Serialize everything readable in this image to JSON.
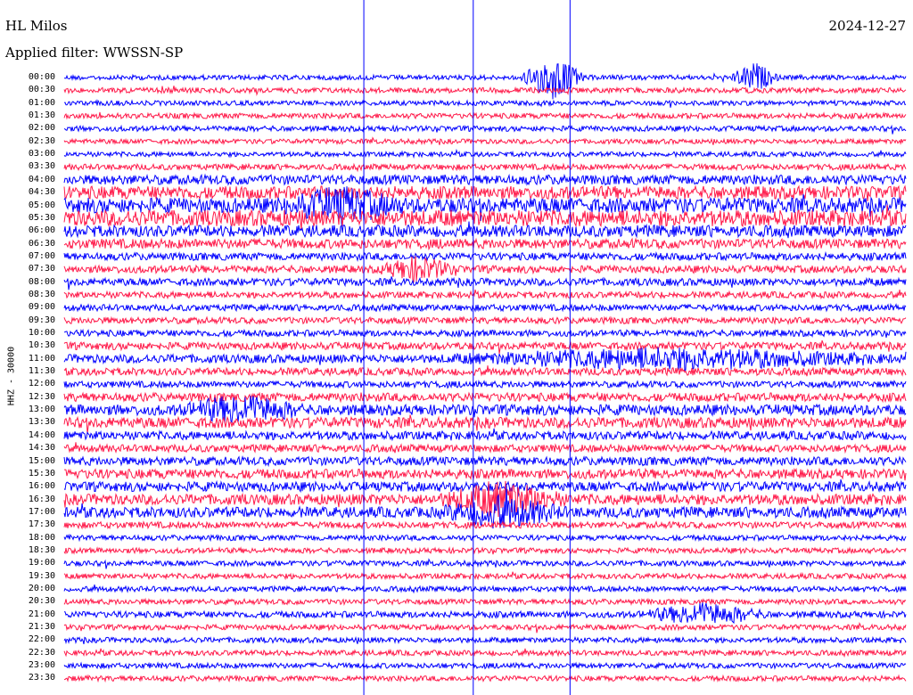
{
  "header": {
    "station": "HL Milos",
    "filter": "Applied filter: WWSSN-SP",
    "date": "2024-12-27"
  },
  "chart_data": {
    "type": "line",
    "ylabel": "HHZ - 30000",
    "rows": [
      "00:00",
      "00:30",
      "01:00",
      "01:30",
      "02:00",
      "02:30",
      "03:00",
      "03:30",
      "04:00",
      "04:30",
      "05:00",
      "05:30",
      "06:00",
      "06:30",
      "07:00",
      "07:30",
      "08:00",
      "08:30",
      "09:00",
      "09:30",
      "10:00",
      "10:30",
      "11:00",
      "11:30",
      "12:00",
      "12:30",
      "13:00",
      "13:30",
      "14:00",
      "14:30",
      "15:00",
      "15:30",
      "16:00",
      "16:30",
      "17:00",
      "17:30",
      "18:00",
      "18:30",
      "19:00",
      "19:30",
      "20:00",
      "20:30",
      "21:00",
      "21:30",
      "22:00",
      "22:30",
      "23:00",
      "23:30"
    ],
    "colors": [
      "#0000ff",
      "#ff1a4a"
    ],
    "noise_level": [
      0.45,
      0.5,
      0.45,
      0.5,
      0.5,
      0.45,
      0.45,
      0.55,
      0.9,
      1.2,
      1.4,
      1.5,
      1.1,
      0.9,
      0.7,
      0.7,
      0.7,
      0.6,
      0.6,
      0.6,
      0.6,
      0.7,
      0.8,
      0.7,
      0.6,
      0.8,
      1.0,
      1.0,
      0.8,
      0.7,
      0.8,
      0.9,
      0.9,
      1.0,
      1.0,
      0.6,
      0.5,
      0.5,
      0.5,
      0.5,
      0.5,
      0.5,
      0.6,
      0.5,
      0.5,
      0.5,
      0.5,
      0.5
    ],
    "events": [
      {
        "row": 0,
        "x": 0.58,
        "w": 0.04,
        "amp": 4
      },
      {
        "row": 0,
        "x": 0.82,
        "w": 0.03,
        "amp": 2.5
      },
      {
        "row": 10,
        "x": 0.33,
        "w": 0.08,
        "amp": 2.5
      },
      {
        "row": 15,
        "x": 0.42,
        "w": 0.05,
        "amp": 2
      },
      {
        "row": 22,
        "x": 0.72,
        "w": 0.28,
        "amp": 1.6
      },
      {
        "row": 26,
        "x": 0.21,
        "w": 0.08,
        "amp": 2.2
      },
      {
        "row": 33,
        "x": 0.52,
        "w": 0.08,
        "amp": 2.8
      },
      {
        "row": 34,
        "x": 0.52,
        "w": 0.08,
        "amp": 2.5
      },
      {
        "row": 42,
        "x": 0.76,
        "w": 0.08,
        "amp": 1.8
      }
    ],
    "spikes": [
      0.356,
      0.486,
      0.601
    ]
  }
}
